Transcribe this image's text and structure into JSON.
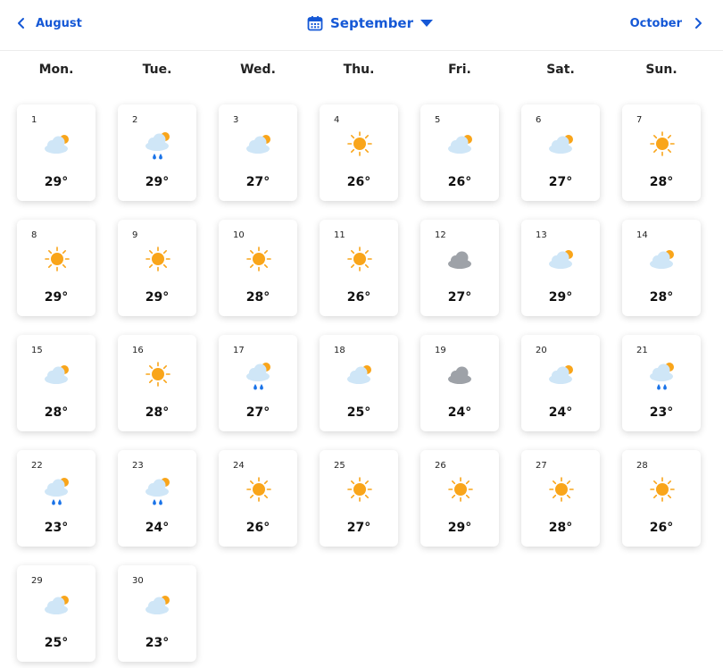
{
  "header": {
    "prev_label": "August",
    "current_label": "September",
    "next_label": "October"
  },
  "weekdays": [
    "Mon.",
    "Tue.",
    "Wed.",
    "Thu.",
    "Fri.",
    "Sat.",
    "Sun."
  ],
  "colors": {
    "accent": "#1558d6",
    "sun": "#f9a51a",
    "cloud_light": "#cfe6f7",
    "cloud_grey": "#9ea2a8",
    "rain": "#1a73e8"
  },
  "days": [
    {
      "day": "1",
      "icon": "partly-cloudy-icon",
      "temp": "29°"
    },
    {
      "day": "2",
      "icon": "partly-cloudy-rain-icon",
      "temp": "29°"
    },
    {
      "day": "3",
      "icon": "partly-cloudy-icon",
      "temp": "27°"
    },
    {
      "day": "4",
      "icon": "sun-icon",
      "temp": "26°"
    },
    {
      "day": "5",
      "icon": "partly-cloudy-icon",
      "temp": "26°"
    },
    {
      "day": "6",
      "icon": "partly-cloudy-icon",
      "temp": "27°"
    },
    {
      "day": "7",
      "icon": "sun-icon",
      "temp": "28°"
    },
    {
      "day": "8",
      "icon": "sun-icon",
      "temp": "29°"
    },
    {
      "day": "9",
      "icon": "sun-icon",
      "temp": "29°"
    },
    {
      "day": "10",
      "icon": "sun-icon",
      "temp": "28°"
    },
    {
      "day": "11",
      "icon": "sun-icon",
      "temp": "26°"
    },
    {
      "day": "12",
      "icon": "cloud-icon",
      "temp": "27°"
    },
    {
      "day": "13",
      "icon": "partly-cloudy-icon",
      "temp": "29°"
    },
    {
      "day": "14",
      "icon": "partly-cloudy-icon",
      "temp": "28°"
    },
    {
      "day": "15",
      "icon": "partly-cloudy-icon",
      "temp": "28°"
    },
    {
      "day": "16",
      "icon": "sun-icon",
      "temp": "28°"
    },
    {
      "day": "17",
      "icon": "partly-cloudy-rain-icon",
      "temp": "27°"
    },
    {
      "day": "18",
      "icon": "partly-cloudy-icon",
      "temp": "25°"
    },
    {
      "day": "19",
      "icon": "cloud-icon",
      "temp": "24°"
    },
    {
      "day": "20",
      "icon": "partly-cloudy-icon",
      "temp": "24°"
    },
    {
      "day": "21",
      "icon": "partly-cloudy-rain-icon",
      "temp": "23°"
    },
    {
      "day": "22",
      "icon": "partly-cloudy-rain-icon",
      "temp": "23°"
    },
    {
      "day": "23",
      "icon": "partly-cloudy-rain-icon",
      "temp": "24°"
    },
    {
      "day": "24",
      "icon": "sun-icon",
      "temp": "26°"
    },
    {
      "day": "25",
      "icon": "sun-icon",
      "temp": "27°"
    },
    {
      "day": "26",
      "icon": "sun-icon",
      "temp": "29°"
    },
    {
      "day": "27",
      "icon": "sun-icon",
      "temp": "28°"
    },
    {
      "day": "28",
      "icon": "sun-icon",
      "temp": "26°"
    },
    {
      "day": "29",
      "icon": "partly-cloudy-icon",
      "temp": "25°"
    },
    {
      "day": "30",
      "icon": "partly-cloudy-icon",
      "temp": "23°"
    }
  ]
}
